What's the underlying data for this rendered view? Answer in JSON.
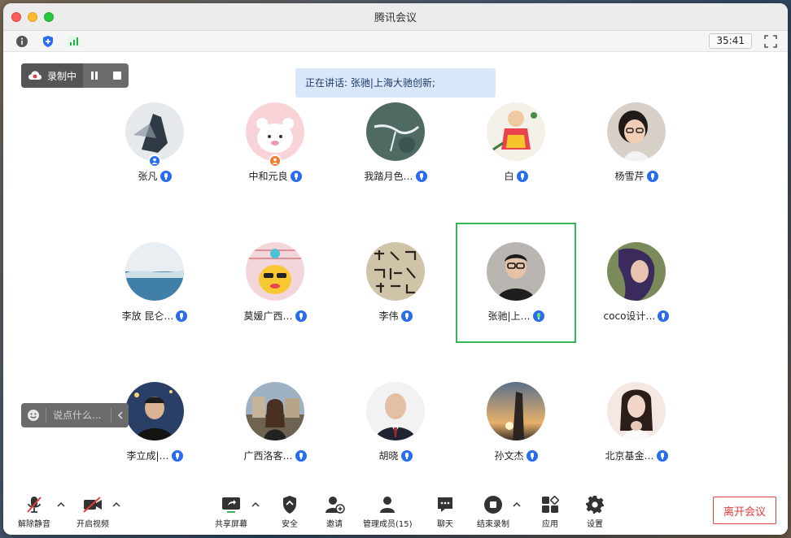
{
  "window": {
    "title": "腾讯会议"
  },
  "infobar": {
    "timer": "35:41"
  },
  "recording": {
    "label": "录制中"
  },
  "speaking": {
    "text": "正在讲话: 张驰|上海大驰创新;"
  },
  "participants": [
    {
      "name": "张凡",
      "badge": "host"
    },
    {
      "name": "中和元良",
      "badge": "cohost"
    },
    {
      "name": "我踏月色…"
    },
    {
      "name": "白"
    },
    {
      "name": "杨雪芹"
    },
    {
      "name": "李放 昆仑…"
    },
    {
      "name": "莫媛广西…"
    },
    {
      "name": "李伟"
    },
    {
      "name": "张驰|上…",
      "active": true
    },
    {
      "name": "coco设计…"
    },
    {
      "name": "李立成|…"
    },
    {
      "name": "广西洛客…"
    },
    {
      "name": "胡晓"
    },
    {
      "name": "孙文杰"
    },
    {
      "name": "北京基金…"
    }
  ],
  "chat": {
    "placeholder": "说点什么..."
  },
  "toolbar": {
    "unmute": "解除静音",
    "video": "开启视频",
    "share": "共享屏幕",
    "security": "安全",
    "invite": "邀请",
    "members": "管理成员(15)",
    "chat": "聊天",
    "stop_record": "结束录制",
    "apps": "应用",
    "settings": "设置",
    "leave": "离开会议"
  },
  "colors": {
    "accent": "#2a6cf0",
    "active_border": "#2fb95a",
    "leave": "#e23c3c"
  }
}
